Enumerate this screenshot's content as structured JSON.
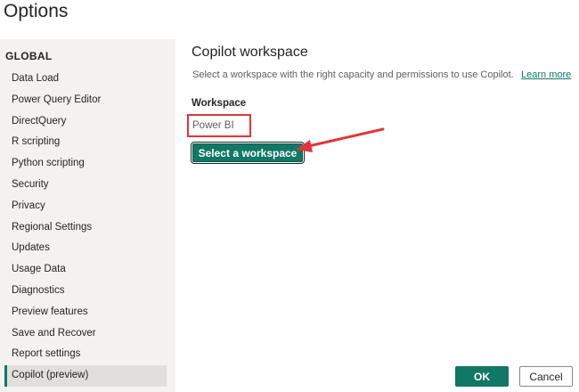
{
  "window": {
    "title": "Options"
  },
  "sidebar": {
    "heading": "GLOBAL",
    "items": [
      {
        "label": "Data Load"
      },
      {
        "label": "Power Query Editor"
      },
      {
        "label": "DirectQuery"
      },
      {
        "label": "R scripting"
      },
      {
        "label": "Python scripting"
      },
      {
        "label": "Security"
      },
      {
        "label": "Privacy"
      },
      {
        "label": "Regional Settings"
      },
      {
        "label": "Updates"
      },
      {
        "label": "Usage Data"
      },
      {
        "label": "Diagnostics"
      },
      {
        "label": "Preview features"
      },
      {
        "label": "Save and Recover"
      },
      {
        "label": "Report settings"
      },
      {
        "label": "Copilot (preview)"
      }
    ],
    "selected_index": 14
  },
  "main": {
    "title": "Copilot workspace",
    "description": "Select a workspace with the right capacity and permissions to use Copilot.",
    "learn_more_label": "Learn more",
    "workspace_label": "Workspace",
    "workspace_value": "Power BI",
    "select_workspace_label": "Select a workspace"
  },
  "footer": {
    "ok_label": "OK",
    "cancel_label": "Cancel"
  },
  "colors": {
    "accent": "#117865",
    "annotation_red": "#e0363b",
    "sidebar_bg": "#f3f2f1"
  }
}
